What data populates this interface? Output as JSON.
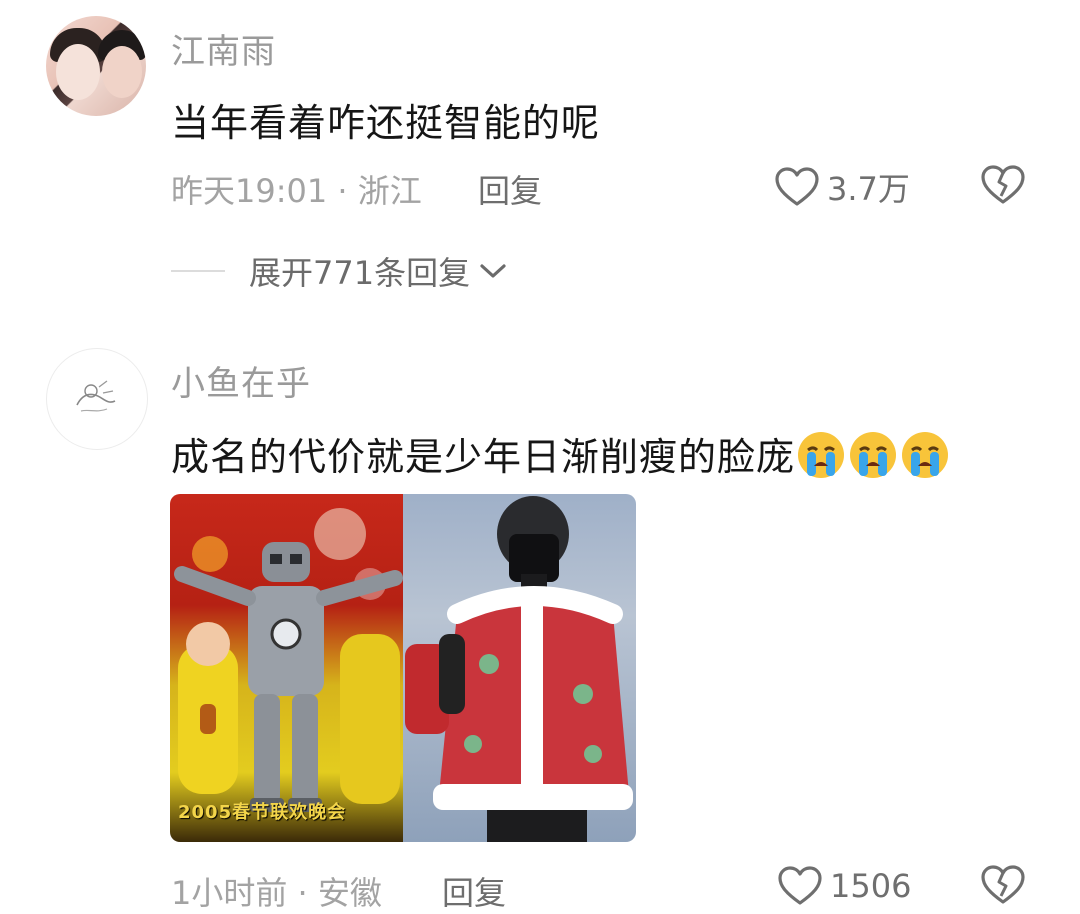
{
  "comments": [
    {
      "username": "江南雨",
      "text": "当年看着咋还挺智能的呢",
      "meta": "昨天19:01 · 浙江",
      "reply_label": "回复",
      "likes": "3.7万",
      "expand_label": "展开771条回复"
    },
    {
      "username": "小鱼在乎",
      "text": "成名的代价就是少年日渐削瘦的脸庞",
      "emoji": [
        "loudly-crying-face",
        "loudly-crying-face",
        "loudly-crying-face"
      ],
      "image_caption": "2005春节联欢晚会",
      "meta": "1小时前 · 安徽",
      "reply_label": "回复",
      "likes": "1506"
    }
  ],
  "icons": {
    "like": "heart-outline-icon",
    "dislike": "broken-heart-icon",
    "expand": "chevron-down-icon"
  },
  "colors": {
    "username": "#9a9a9a",
    "text": "#161616",
    "meta": "#a3a3a3"
  }
}
